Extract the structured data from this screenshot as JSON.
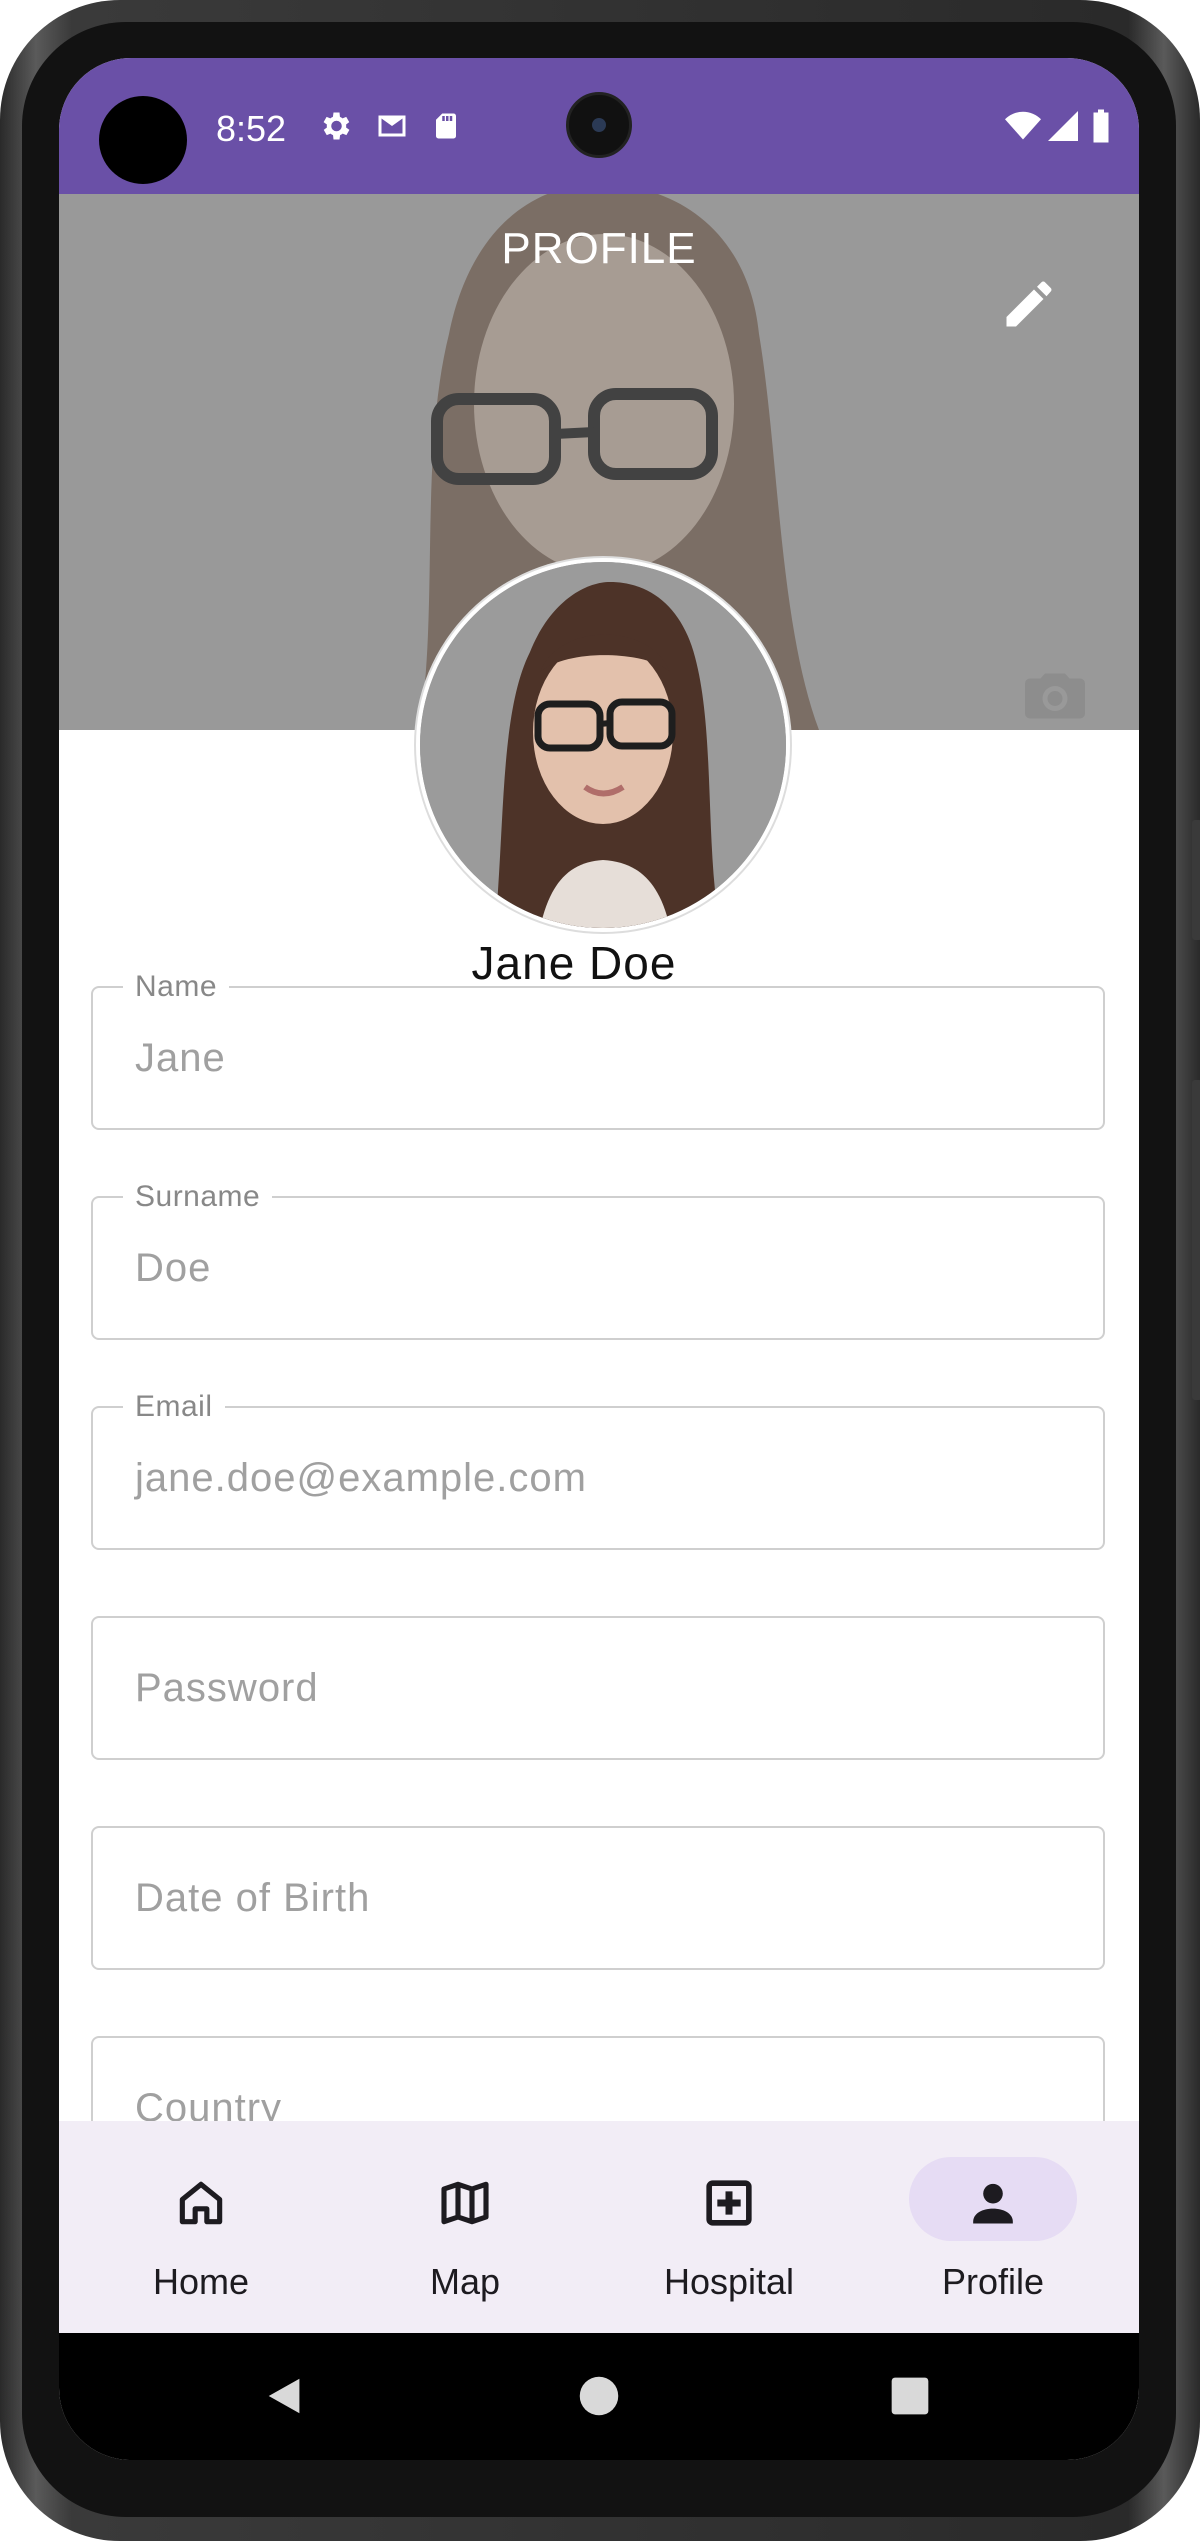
{
  "status_bar": {
    "time": "8:52",
    "left_icons": [
      "settings-icon",
      "gmail-icon",
      "sd-card-icon"
    ],
    "right_icons": [
      "wifi-icon",
      "signal-icon",
      "battery-icon"
    ]
  },
  "header": {
    "title": "PROFILE",
    "edit_icon": "pencil-icon",
    "camera_icon": "camera-icon"
  },
  "profile": {
    "display_name": "Jane Doe"
  },
  "form": {
    "name": {
      "label": "Name",
      "value": "Jane"
    },
    "surname": {
      "label": "Surname",
      "value": "Doe"
    },
    "email": {
      "label": "Email",
      "value": "jane.doe@example.com"
    },
    "password": {
      "placeholder": "Password"
    },
    "date_of_birth": {
      "placeholder": "Date of Birth"
    },
    "country": {
      "placeholder": "Country"
    }
  },
  "bottom_nav": {
    "items": [
      {
        "label": "Home",
        "icon": "home-icon",
        "active": false
      },
      {
        "label": "Map",
        "icon": "map-icon",
        "active": false
      },
      {
        "label": "Hospital",
        "icon": "hospital-icon",
        "active": false
      },
      {
        "label": "Profile",
        "icon": "person-icon",
        "active": true
      }
    ]
  },
  "colors": {
    "status_bar": "#6a50a7",
    "nav_background": "#f2edf6",
    "active_pill": "#e6dcf4"
  }
}
